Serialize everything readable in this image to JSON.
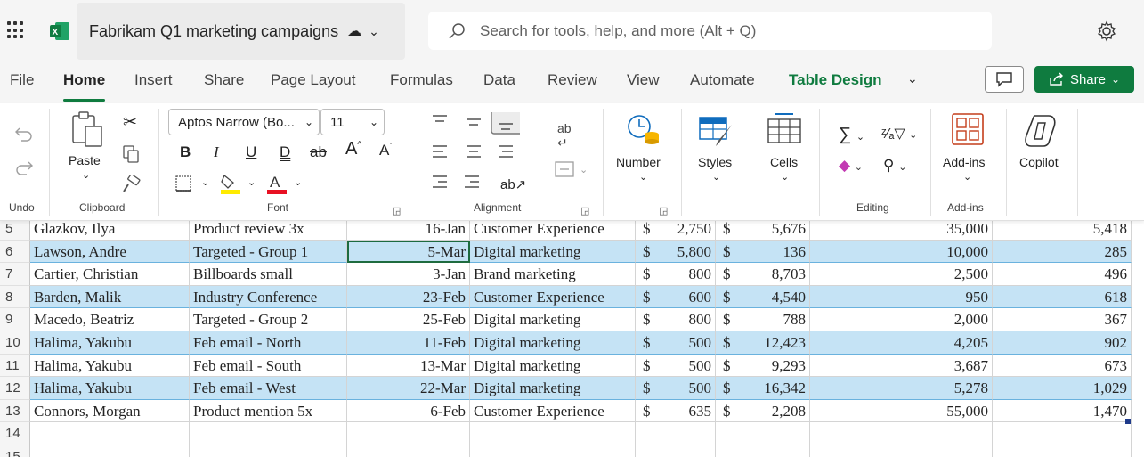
{
  "app": {
    "doc_title": "Fabrikam Q1 marketing campaigns",
    "search_placeholder": "Search for tools, help, and more (Alt + Q)"
  },
  "tabs": [
    "File",
    "Home",
    "Insert",
    "Share",
    "Page Layout",
    "Formulas",
    "Data",
    "Review",
    "View",
    "Automate",
    "Table Design"
  ],
  "share_label": "Share",
  "ribbon": {
    "undo_label": "Undo",
    "paste_label": "Paste",
    "clipboard_label": "Clipboard",
    "font_name": "Aptos Narrow (Bo...",
    "font_size": "11",
    "font_label": "Font",
    "alignment_label": "Alignment",
    "number_label": "Number",
    "styles_label": "Styles",
    "cells_label": "Cells",
    "editing_label": "Editing",
    "addins_label": "Add-ins",
    "addins_group_label": "Add-ins",
    "copilot_label": "Copilot"
  },
  "rows": [
    {
      "num": "5",
      "name": "Glazkov, Ilya",
      "campaign": "Product review 3x",
      "date": "16-Jan",
      "category": "Customer Experience",
      "cost": "2,750",
      "rev": "5,676",
      "reach": "35,000",
      "conv": "5,418",
      "band": false
    },
    {
      "num": "6",
      "name": "Lawson, Andre",
      "campaign": "Targeted - Group 1",
      "date": "5-Mar",
      "category": "Digital marketing",
      "cost": "5,800",
      "rev": "136",
      "reach": "10,000",
      "conv": "285",
      "band": true
    },
    {
      "num": "7",
      "name": "Cartier, Christian",
      "campaign": "Billboards small",
      "date": "3-Jan",
      "category": "Brand marketing",
      "cost": "800",
      "rev": "8,703",
      "reach": "2,500",
      "conv": "496",
      "band": false
    },
    {
      "num": "8",
      "name": "Barden, Malik",
      "campaign": "Industry Conference",
      "date": "23-Feb",
      "category": "Customer Experience",
      "cost": "600",
      "rev": "4,540",
      "reach": "950",
      "conv": "618",
      "band": true
    },
    {
      "num": "9",
      "name": "Macedo, Beatriz",
      "campaign": "Targeted - Group 2",
      "date": "25-Feb",
      "category": "Digital marketing",
      "cost": "800",
      "rev": "788",
      "reach": "2,000",
      "conv": "367",
      "band": false
    },
    {
      "num": "10",
      "name": "Halima, Yakubu",
      "campaign": "Feb email - North",
      "date": "11-Feb",
      "category": "Digital marketing",
      "cost": "500",
      "rev": "12,423",
      "reach": "4,205",
      "conv": "902",
      "band": true
    },
    {
      "num": "11",
      "name": "Halima, Yakubu",
      "campaign": "Feb email - South",
      "date": "13-Mar",
      "category": "Digital marketing",
      "cost": "500",
      "rev": "9,293",
      "reach": "3,687",
      "conv": "673",
      "band": false
    },
    {
      "num": "12",
      "name": "Halima, Yakubu",
      "campaign": "Feb email - West",
      "date": "22-Mar",
      "category": "Digital marketing",
      "cost": "500",
      "rev": "16,342",
      "reach": "5,278",
      "conv": "1,029",
      "band": true
    },
    {
      "num": "13",
      "name": "Connors, Morgan",
      "campaign": "Product mention 5x",
      "date": "6-Feb",
      "category": "Customer Experience",
      "cost": "635",
      "rev": "2,208",
      "reach": "55,000",
      "conv": "1,470",
      "band": false
    },
    {
      "num": "14",
      "name": "",
      "campaign": "",
      "date": "",
      "category": "",
      "cost": "",
      "rev": "",
      "reach": "",
      "conv": "",
      "band": false
    },
    {
      "num": "15",
      "name": "",
      "campaign": "",
      "date": "",
      "category": "",
      "cost": "",
      "rev": "",
      "reach": "",
      "conv": "",
      "band": false
    }
  ],
  "currency_symbol": "$",
  "colors": {
    "accent": "#0f7b3f",
    "band": "#c5e3f5"
  }
}
